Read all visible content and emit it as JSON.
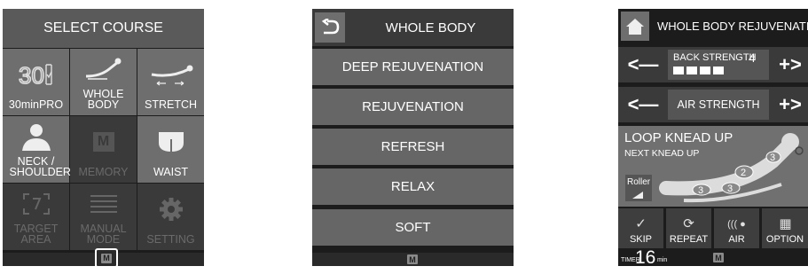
{
  "panel1": {
    "title": "SELECT COURSE",
    "tiles": [
      {
        "label": "30minPRO",
        "icon": "30-minute-icon",
        "enabled": true
      },
      {
        "label": "WHOLE BODY",
        "icon": "reclining-body-icon",
        "enabled": true
      },
      {
        "label": "STRETCH",
        "icon": "stretch-icon",
        "enabled": true
      },
      {
        "label": "NECK / SHOULDER",
        "icon": "neck-shoulder-icon",
        "enabled": true
      },
      {
        "label": "MEMORY",
        "icon": "memory-m-icon",
        "enabled": false
      },
      {
        "label": "WAIST",
        "icon": "waist-icon",
        "enabled": true
      },
      {
        "label": "TARGET AREA",
        "icon": "target-bracket-icon",
        "enabled": false
      },
      {
        "label": "MANUAL MODE",
        "icon": "list-lines-icon",
        "enabled": false
      },
      {
        "label": "SETTING",
        "icon": "gear-icon",
        "enabled": false
      }
    ],
    "memory_glyph": "M"
  },
  "panel2": {
    "title": "WHOLE BODY",
    "options": [
      "DEEP REJUVENATION",
      "REJUVENATION",
      "REFRESH",
      "RELAX",
      "SOFT"
    ],
    "memory_glyph": "M"
  },
  "panel3": {
    "title": "WHOLE BODY REJUVENATION",
    "back_strength_label": "BACK STRENGTH",
    "back_strength_value": "4",
    "back_strength_level": 4,
    "air_strength_label": "AIR STRENGTH",
    "minus": "<—",
    "plus": "+>",
    "current_technique": "LOOP KNEAD UP",
    "next_technique": "NEXT KNEAD UP",
    "roller_label": "Roller",
    "zones": [
      "2",
      "3",
      "3",
      "3"
    ],
    "toolbar": [
      "SKIP",
      "REPEAT",
      "AIR",
      "OPTION"
    ],
    "timer_label": "TIMER",
    "timer_value": "16",
    "timer_unit": "min",
    "memory_glyph": "M"
  },
  "colors": {
    "tile_active": "#6e6e6e",
    "tile_disabled": "#3a3a3a",
    "background": "#1c1c1c"
  }
}
